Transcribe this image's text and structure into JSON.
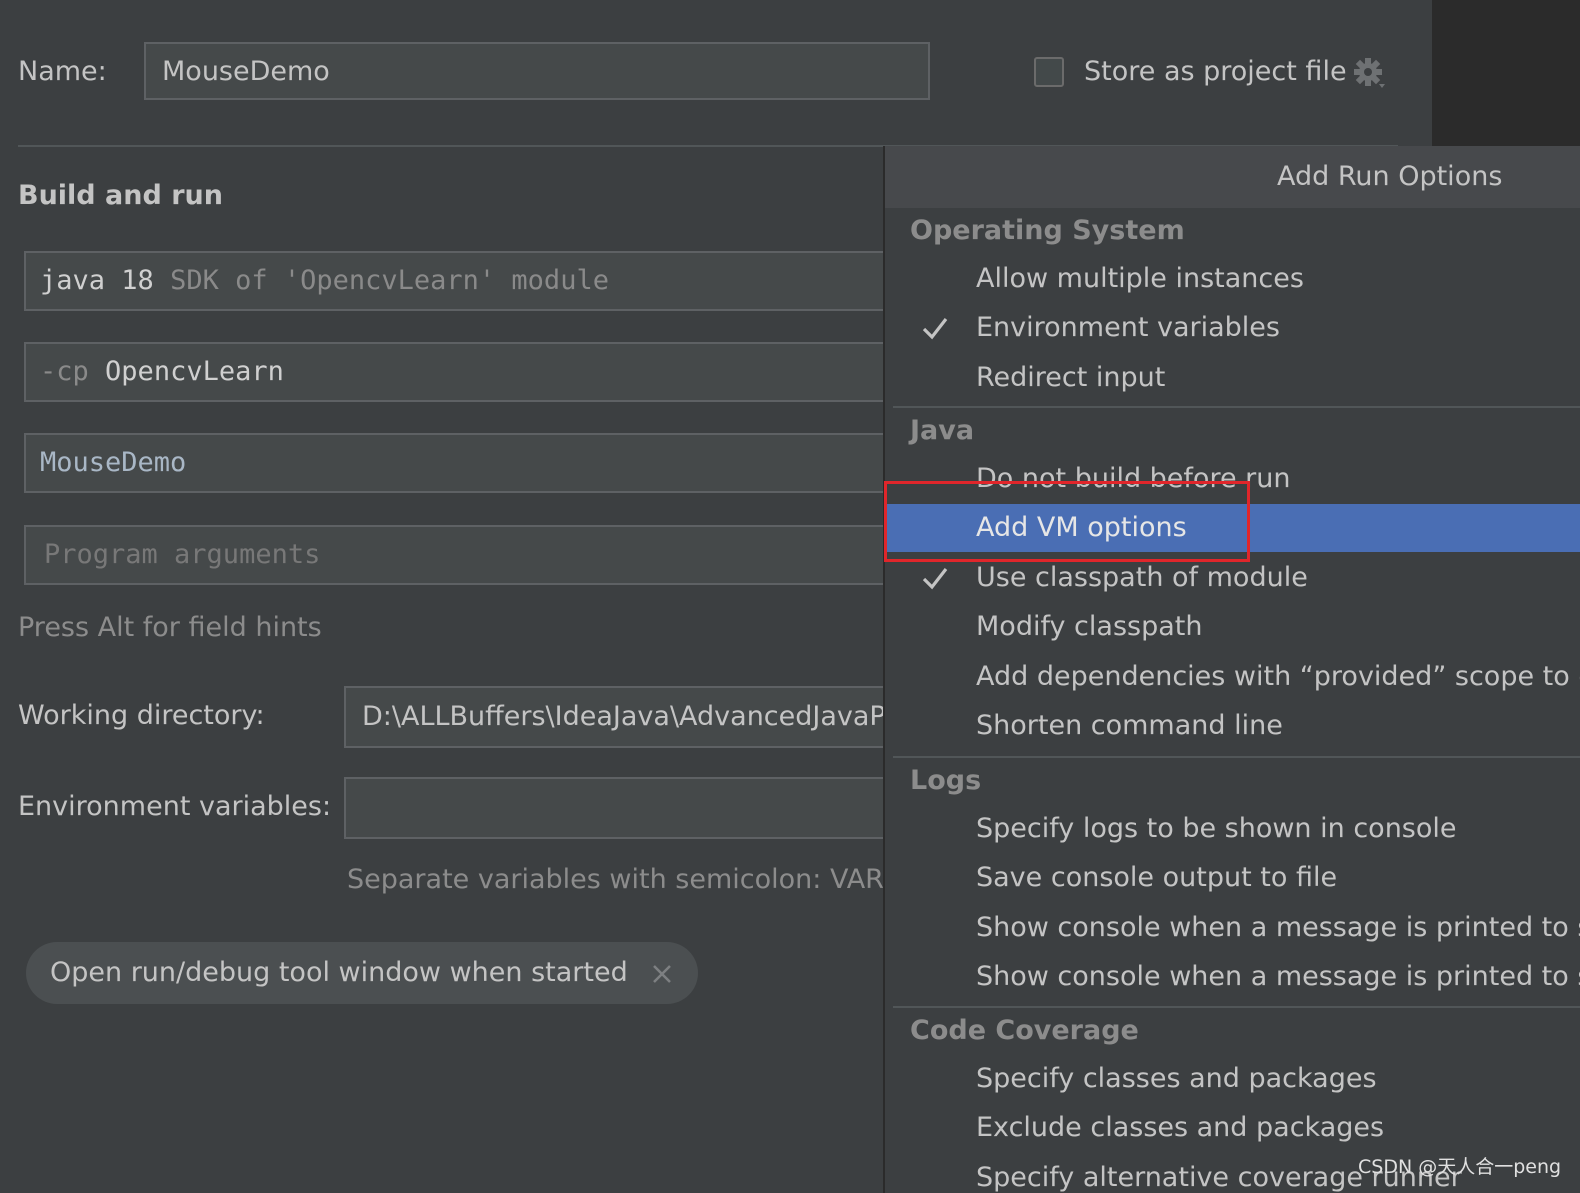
{
  "header": {
    "name_label": "Name:",
    "name_value": "MouseDemo",
    "store_label": "Store as project file",
    "store_checked": false
  },
  "build": {
    "section_title": "Build and run",
    "jre_main": "java 18",
    "jre_dim": "SDK of 'OpencvLearn' module",
    "cp_prefix": "-cp",
    "cp_value": "OpencvLearn",
    "main_class": "MouseDemo",
    "program_args_placeholder": "Program arguments",
    "hint": "Press Alt for field hints"
  },
  "working_dir": {
    "label": "Working directory:",
    "value": "D:\\ALLBuffers\\IdeaJava\\AdvancedJavaP"
  },
  "env": {
    "label": "Environment variables:",
    "value": "",
    "hint": "Separate variables with semicolon: VAR="
  },
  "chip": {
    "label": "Open run/debug tool window when started"
  },
  "popup": {
    "title": "Add Run Options",
    "groups": [
      {
        "header": "Operating System",
        "items": [
          {
            "label": "Allow multiple instances",
            "checked": false
          },
          {
            "label": "Environment variables",
            "checked": true
          },
          {
            "label": "Redirect input",
            "checked": false
          }
        ]
      },
      {
        "header": "Java",
        "items": [
          {
            "label": "Do not build before run",
            "checked": false
          },
          {
            "label": "Add VM options",
            "checked": false,
            "selected": true
          },
          {
            "label": "Use classpath of module",
            "checked": true
          },
          {
            "label": "Modify classpath",
            "checked": false
          },
          {
            "label": "Add dependencies with “provided” scope to c",
            "checked": false
          },
          {
            "label": "Shorten command line",
            "checked": false
          }
        ]
      },
      {
        "header": "Logs",
        "items": [
          {
            "label": "Specify logs to be shown in console",
            "checked": false
          },
          {
            "label": "Save console output to file",
            "checked": false
          },
          {
            "label": "Show console when a message is printed to s",
            "checked": false
          },
          {
            "label": "Show console when a message is printed to s",
            "checked": false
          }
        ]
      },
      {
        "header": "Code Coverage",
        "items": [
          {
            "label": "Specify classes and packages",
            "checked": false
          },
          {
            "label": "Exclude classes and packages",
            "checked": false
          },
          {
            "label": "Specify alternative coverage runner",
            "checked": false
          }
        ]
      }
    ]
  },
  "watermark": "CSDN @天人合一peng",
  "colors": {
    "background": "#3c3f41",
    "selection": "#4a6eb4",
    "highlight_box": "#e0262b"
  }
}
